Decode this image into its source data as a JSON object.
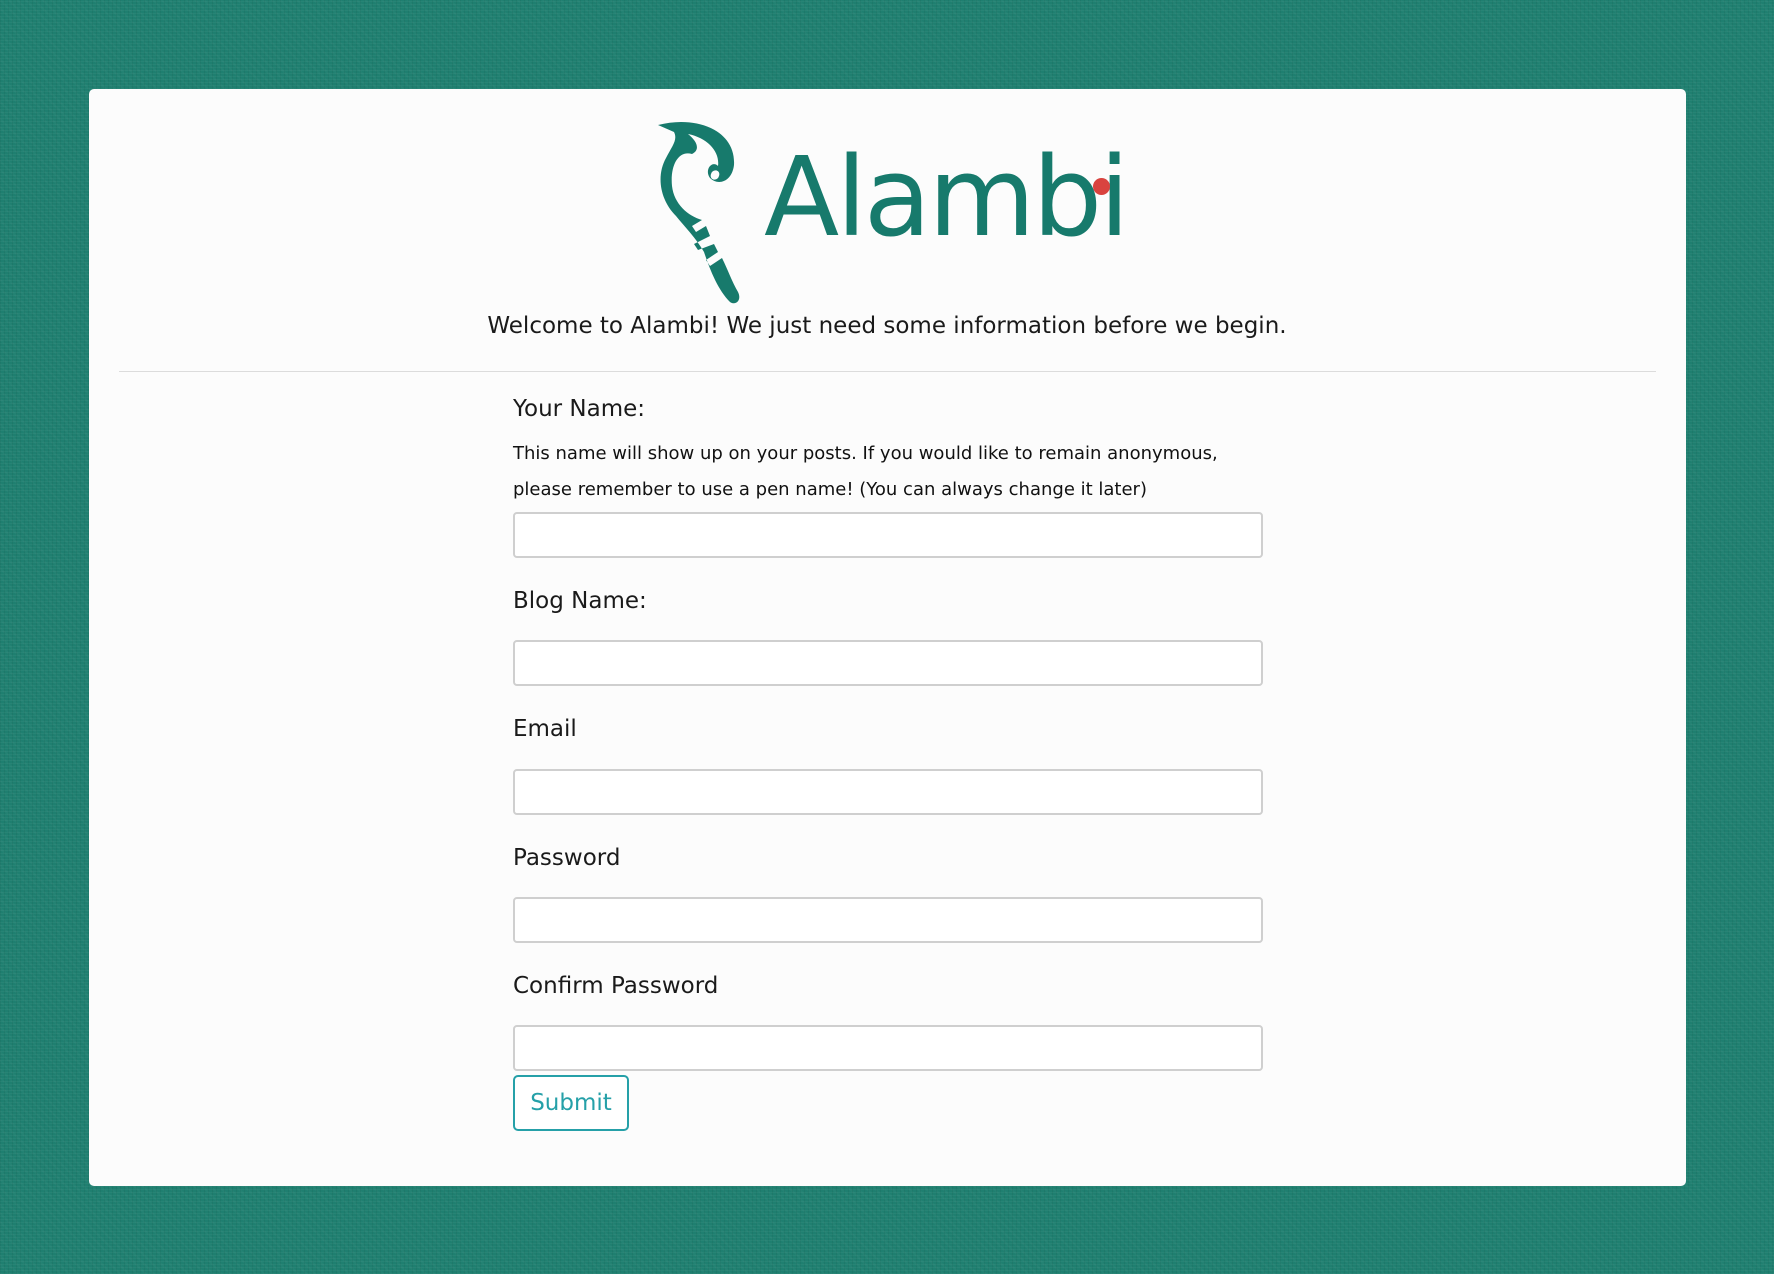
{
  "brand": {
    "name": "Alambi",
    "logo_color": "#177a6c",
    "dot_color": "#d9433f"
  },
  "welcome_text": "Welcome to Alambi! We just need some information before we begin.",
  "form": {
    "name_label": "Your Name:",
    "name_hint_line1": "This name will show up on your posts. If you would like to remain anonymous,",
    "name_hint_line2": "please remember to use a pen name! (You can always change it later)",
    "name_value": "",
    "blog_label": "Blog Name:",
    "blog_value": "",
    "email_label": "Email",
    "email_value": "",
    "password_label": "Password",
    "password_value": "",
    "confirm_label": "Confirm Password",
    "confirm_value": "",
    "submit_label": "Submit"
  },
  "colors": {
    "background": "#1f7f70",
    "card": "#fcfcfc",
    "accent": "#25a0a8"
  }
}
